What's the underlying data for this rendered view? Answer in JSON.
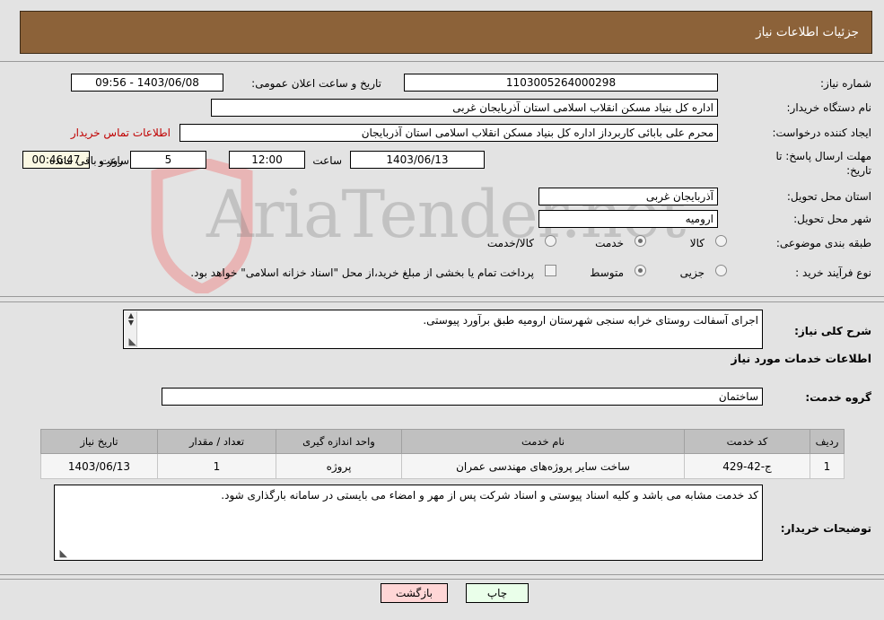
{
  "header": {
    "title": "جزئیات اطلاعات نیاز",
    "bar_color": "#8c6239"
  },
  "watermark": {
    "text": "AriaTender.net",
    "shield_color": "#e8b5b5"
  },
  "fields": {
    "need_number_label": "شماره نیاز:",
    "need_number_value": "1103005264000298",
    "public_announce_label": "تاریخ و ساعت اعلان عمومی:",
    "public_announce_value": "1403/06/08 - 09:56",
    "buyer_org_label": "نام دستگاه خریدار:",
    "buyer_org_value": "اداره کل بنیاد مسکن انقلاب اسلامی استان آذربایجان غربی",
    "creator_label": "ایجاد کننده درخواست:",
    "creator_value": "محرم علی بابائی کاربرداز اداره کل بنیاد مسکن انقلاب اسلامی استان آذربایجان",
    "buyer_contact_link": "اطلاعات تماس خریدار",
    "deadline_label": "مهلت ارسال پاسخ: تا تاریخ:",
    "deadline_date": "1403/06/13",
    "hour_word": "ساعت",
    "deadline_time": "12:00",
    "days_remaining": "5",
    "days_word": "روز و",
    "countdown": "00:46:47",
    "remaining_word": "ساعت باقی مانده",
    "province_label": "استان محل تحویل:",
    "province_value": "آذربایجان غربی",
    "city_label": "شهر محل تحویل:",
    "city_value": "ارومیه",
    "category_label": "طبقه بندی موضوعی:",
    "category_options": [
      {
        "label": "کالا",
        "selected": false
      },
      {
        "label": "خدمت",
        "selected": true
      },
      {
        "label": "کالا/خدمت",
        "selected": false
      }
    ],
    "process_label": "نوع فرآیند خرید :",
    "process_options": [
      {
        "label": "جزیی",
        "selected": false
      },
      {
        "label": "متوسط",
        "selected": true
      }
    ],
    "treasury_checkbox_label": "پرداخت تمام یا بخشی از مبلغ خرید،از محل \"اسناد خزانه اسلامی\" خواهد بود.",
    "treasury_checked": false
  },
  "summary": {
    "label": "شرح کلی نیاز:",
    "value": "اجرای آسفالت روستای خرابه سنجی شهرستان ارومیه طبق برآورد پیوستی."
  },
  "services": {
    "section_title": "اطلاعات خدمات مورد نیاز",
    "group_label": "گروه خدمت:",
    "group_value": "ساختمان",
    "columns": [
      "ردیف",
      "کد خدمت",
      "نام خدمت",
      "واحد اندازه گیری",
      "تعداد / مقدار",
      "تاریخ نیاز"
    ],
    "rows": [
      {
        "row": "1",
        "code": "ج-42-429",
        "name": "ساخت سایر پروژه‌های مهندسی عمران",
        "unit": "پروژه",
        "qty": "1",
        "date": "1403/06/13"
      }
    ]
  },
  "buyer_notes": {
    "label": "توضیحات خریدار:",
    "value": "کد خدمت مشابه می باشد و کلیه اسناد پیوستی و اسناد شرکت پس از مهر و امضاء می بایستی در سامانه بارگذاری شود."
  },
  "footer": {
    "print_label": "چاپ",
    "back_label": "بازگشت"
  }
}
